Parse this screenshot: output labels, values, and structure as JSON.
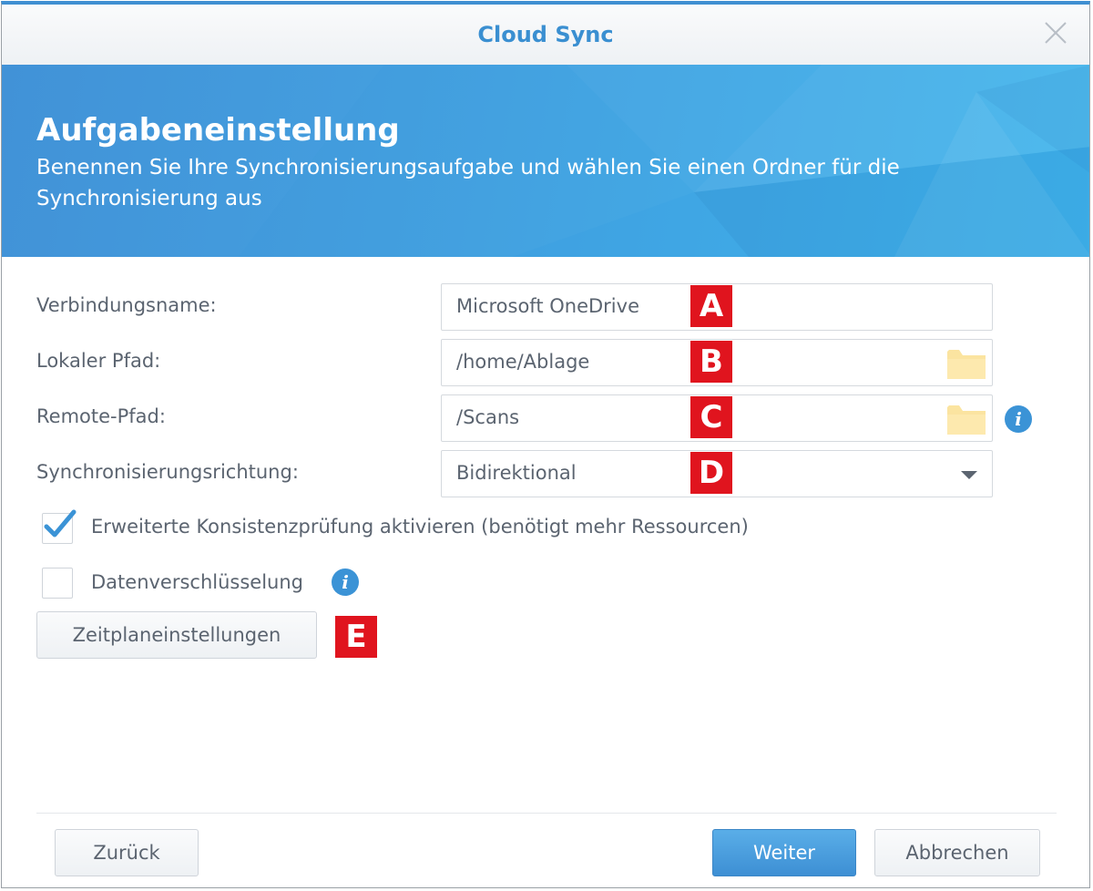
{
  "window": {
    "title": "Cloud Sync"
  },
  "banner": {
    "heading": "Aufgabeneinstellung",
    "subtitle": "Benennen Sie Ihre Synchronisierungsaufgabe und wählen Sie einen Ordner für die Synchronisierung aus"
  },
  "form": {
    "connection_name": {
      "label": "Verbindungsname:",
      "value": "Microsoft OneDrive",
      "marker": "A"
    },
    "local_path": {
      "label": "Lokaler Pfad:",
      "value": "/home/Ablage",
      "marker": "B"
    },
    "remote_path": {
      "label": "Remote-Pfad:",
      "value": "/Scans",
      "marker": "C"
    },
    "sync_direction": {
      "label": "Synchronisierungsrichtung:",
      "value": "Bidirektional",
      "marker": "D"
    },
    "consistency_check": {
      "label": "Erweiterte Konsistenzprüfung aktivieren (benötigt mehr Ressourcen)",
      "checked": true
    },
    "data_encryption": {
      "label": "Datenverschlüsselung",
      "checked": false
    },
    "schedule_button": {
      "label": "Zeitplaneinstellungen",
      "marker": "E"
    }
  },
  "footer": {
    "back_label": "Zurück",
    "next_label": "Weiter",
    "cancel_label": "Abbrechen"
  },
  "icons": {
    "close": "close-icon",
    "folder": "folder-icon",
    "info": "info-icon",
    "checkmark": "checkmark-icon",
    "dropdown": "chevron-down-icon"
  },
  "colors": {
    "accent": "#3a8fd1",
    "banner": "#3f9fe0",
    "marker": "#e0141e",
    "folder": "#fbe4a0",
    "primary_button": "#4a9fe0"
  }
}
